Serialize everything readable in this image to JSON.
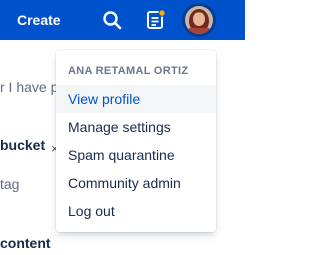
{
  "topbar": {
    "create_label": "Create",
    "search_icon": "search-icon",
    "notification_icon": "notification-icon",
    "avatar": "avatar"
  },
  "background": {
    "line1": "r I have p",
    "line2": "bucket",
    "close_glyph": "×",
    "line3": "tag",
    "line4": "content"
  },
  "profile_menu": {
    "user_name": "ANA RETAMAL ORTIZ",
    "items": [
      {
        "label": "View profile"
      },
      {
        "label": "Manage settings"
      },
      {
        "label": "Spam quarantine"
      },
      {
        "label": "Community admin"
      },
      {
        "label": "Log out"
      }
    ]
  },
  "colors": {
    "topbar_bg": "#0052cc",
    "link": "#0052cc",
    "text": "#172b4d",
    "muted": "#6b778c",
    "hover_bg": "#f4f5f7",
    "notification_badge": "#ffab00"
  }
}
